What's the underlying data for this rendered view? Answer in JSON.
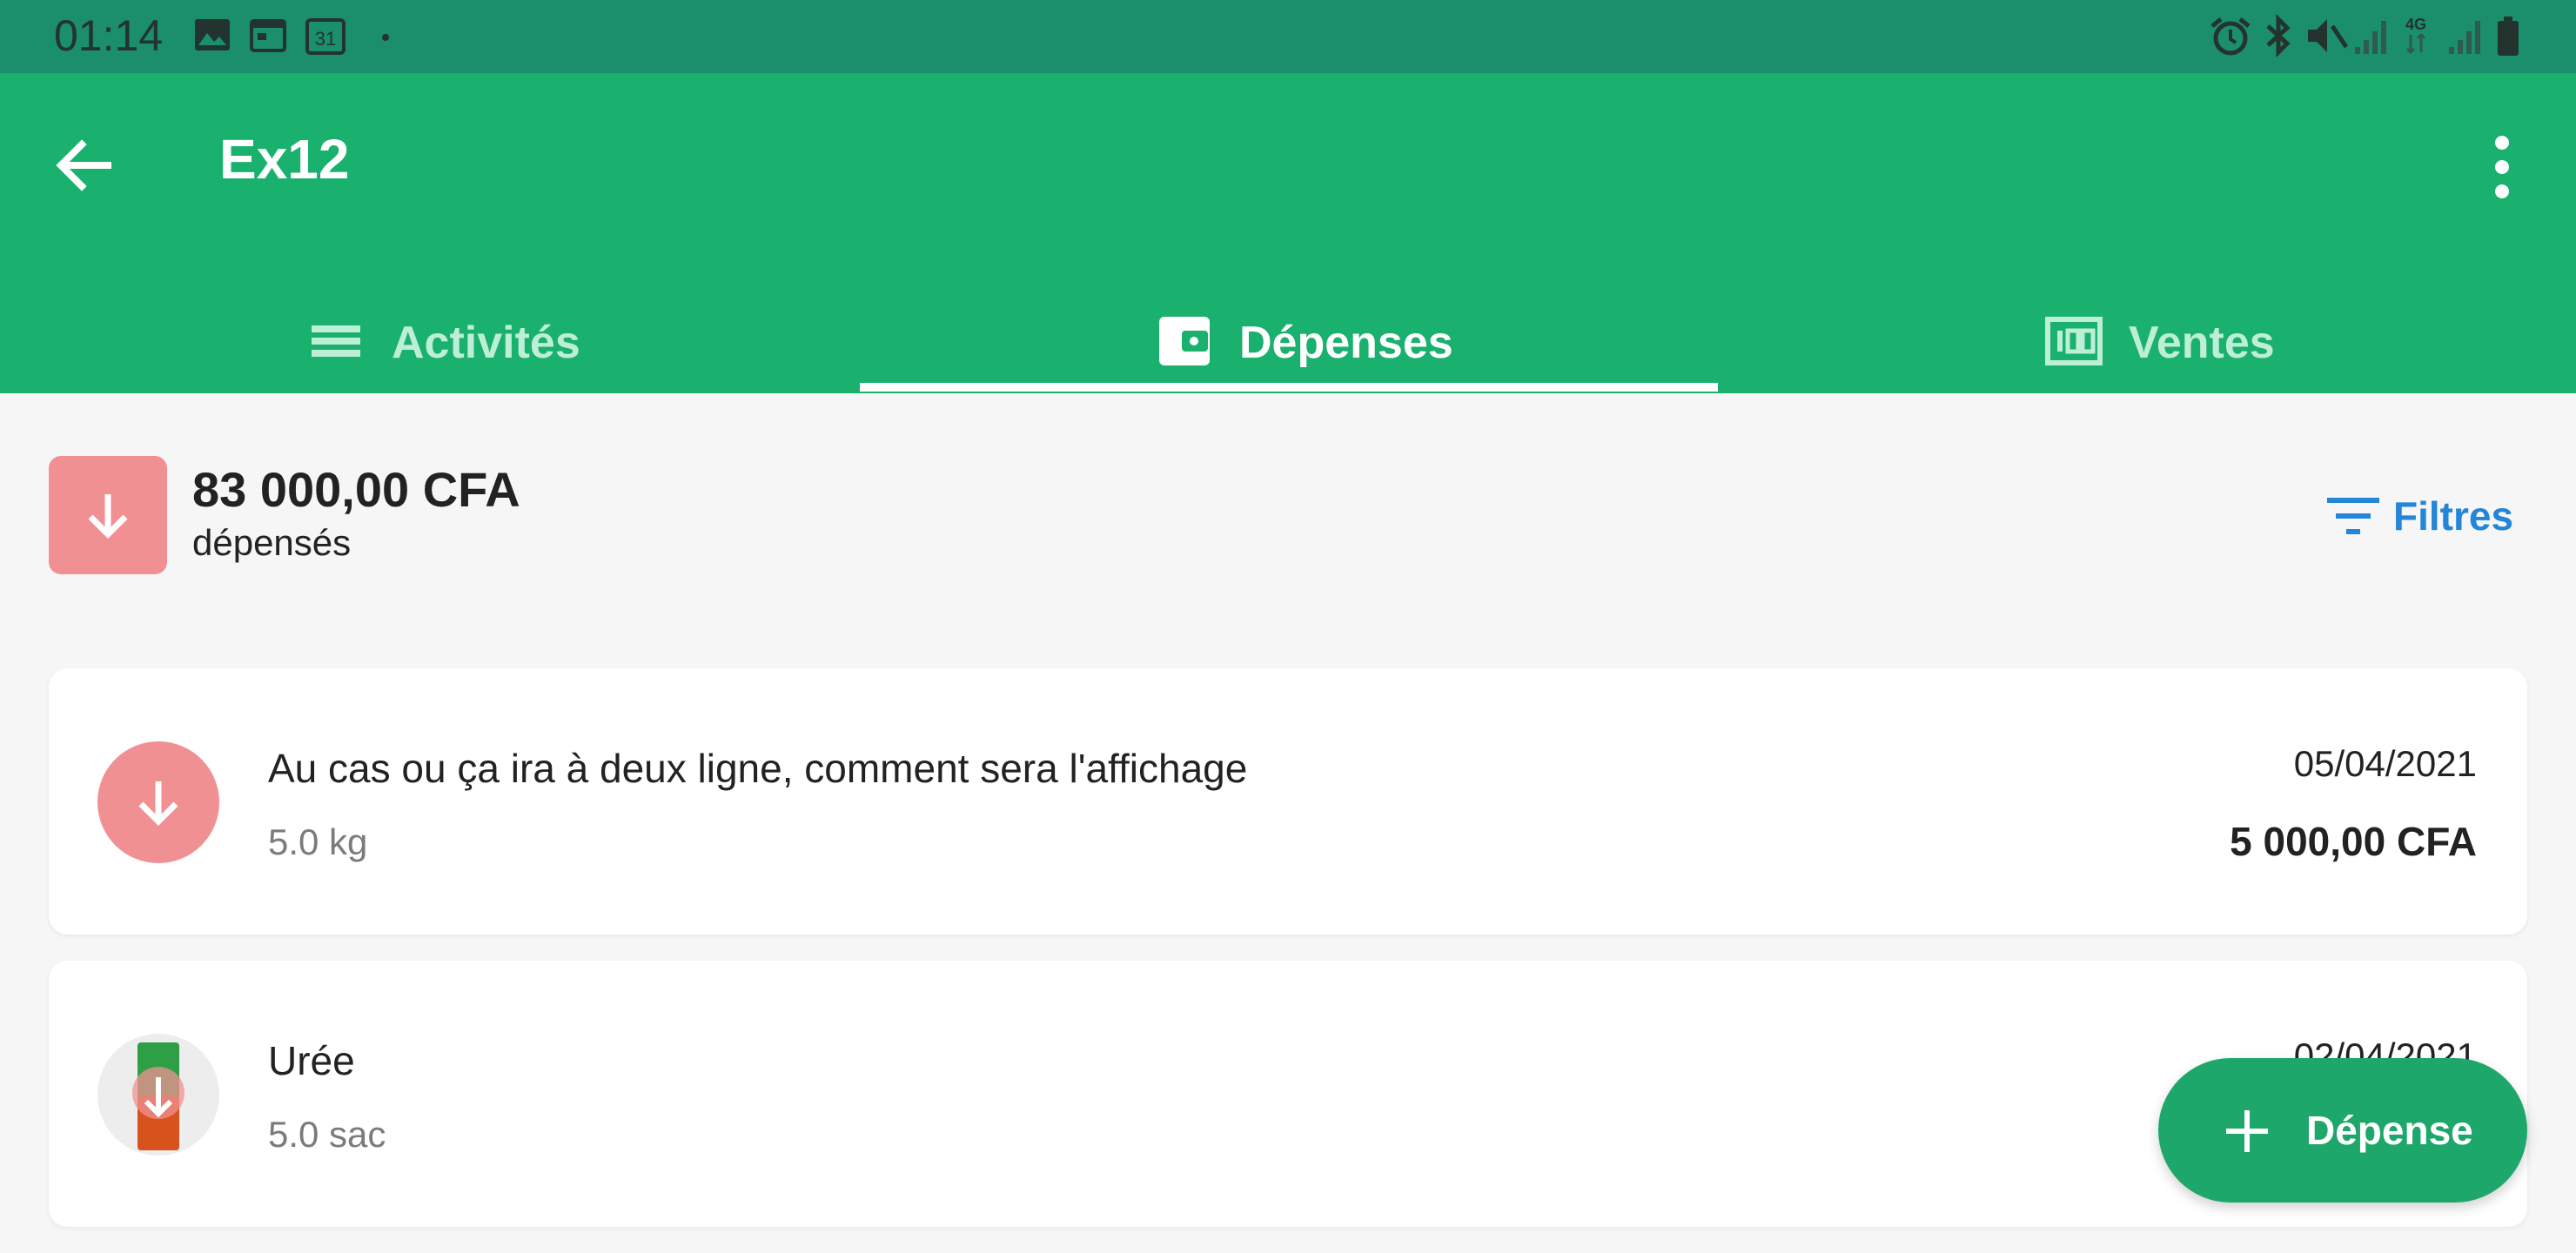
{
  "status_bar": {
    "time": "01:14",
    "left_icons": [
      "image-icon",
      "calendar-icon",
      "calendar-31-icon",
      "dot-icon"
    ],
    "calendar_day": "31",
    "right_icons": [
      "alarm-icon",
      "bluetooth-icon",
      "mute-icon",
      "signal-icon",
      "network-4g-icon",
      "signal-icon",
      "battery-icon"
    ],
    "network": "4G"
  },
  "header": {
    "title": "Ex12",
    "back_icon": "arrow-left-icon",
    "menu_icon": "more-vertical-icon"
  },
  "tabs": [
    {
      "label": "Activités",
      "icon": "list-icon",
      "active": false
    },
    {
      "label": "Dépenses",
      "icon": "wallet-icon",
      "active": true
    },
    {
      "label": "Ventes",
      "icon": "cash-icon",
      "active": false
    }
  ],
  "summary": {
    "amount": "83 000,00 CFA",
    "subtitle": "dépensés",
    "icon": "arrow-down-icon",
    "filter_label": "Filtres",
    "filter_icon": "filter-icon"
  },
  "expenses": [
    {
      "title": "Au cas ou ça ira à deux ligne, comment sera l'affichage",
      "quantity": "5.0 kg",
      "date": "05/04/2021",
      "amount": "5 000,00 CFA",
      "icon": "arrow-down-icon"
    },
    {
      "title": "Urée",
      "quantity": "5.0 sac",
      "date": "02/04/2021",
      "amount": "",
      "icon": "product-bag-icon"
    }
  ],
  "fab": {
    "label": "Dépense",
    "icon": "plus-icon"
  },
  "colors": {
    "primary": "#1ab06e",
    "status_bar": "#1b8e6b",
    "expense_red": "#f19092",
    "link_blue": "#2386d9",
    "fab": "#1ea76a"
  }
}
